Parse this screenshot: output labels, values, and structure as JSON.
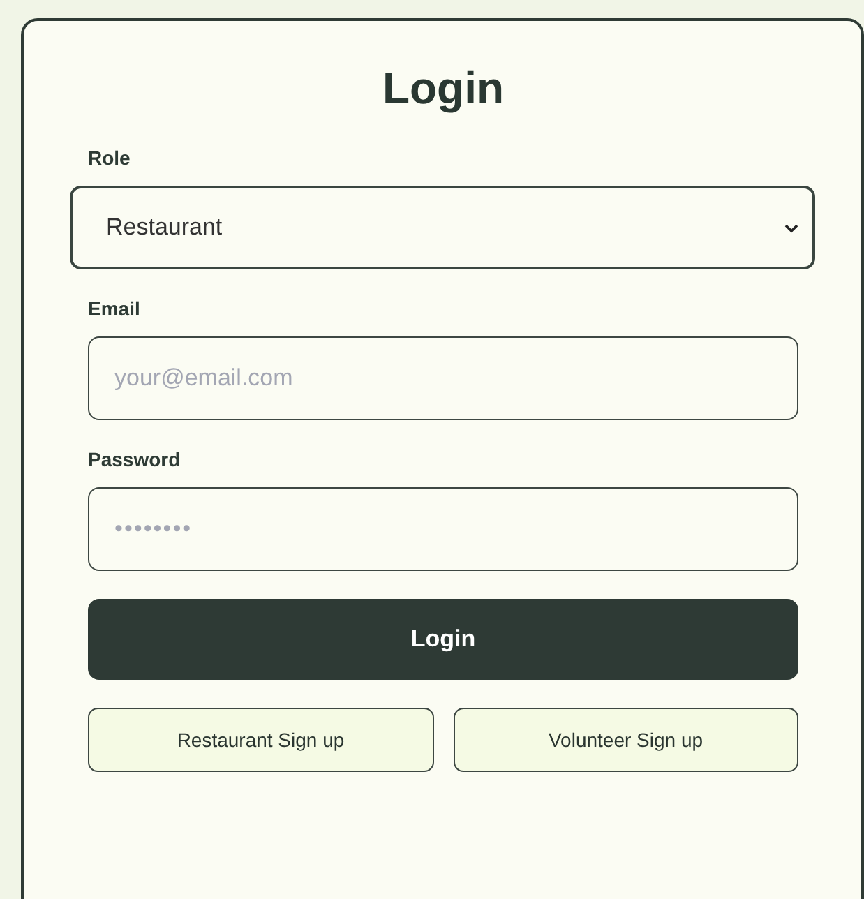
{
  "title": "Login",
  "fields": [
    {
      "kind": "select",
      "label": "Role",
      "value": "Restaurant"
    },
    {
      "kind": "email",
      "label": "Email",
      "placeholder": "your@email.com"
    },
    {
      "kind": "password",
      "label": "Password",
      "placeholder": "••••••••"
    }
  ],
  "submit": "Login",
  "signup_buttons": [
    "Restaurant Sign up",
    "Volunteer Sign up"
  ]
}
